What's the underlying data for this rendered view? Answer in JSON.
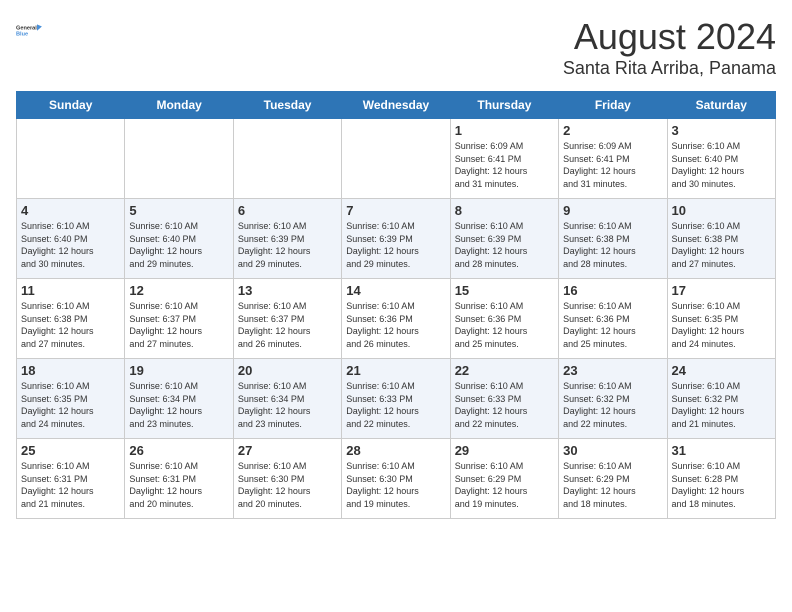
{
  "logo": {
    "line1": "General",
    "line2": "Blue"
  },
  "title": "August 2024",
  "subtitle": "Santa Rita Arriba, Panama",
  "weekdays": [
    "Sunday",
    "Monday",
    "Tuesday",
    "Wednesday",
    "Thursday",
    "Friday",
    "Saturday"
  ],
  "weeks": [
    [
      {
        "day": "",
        "info": ""
      },
      {
        "day": "",
        "info": ""
      },
      {
        "day": "",
        "info": ""
      },
      {
        "day": "",
        "info": ""
      },
      {
        "day": "1",
        "info": "Sunrise: 6:09 AM\nSunset: 6:41 PM\nDaylight: 12 hours\nand 31 minutes."
      },
      {
        "day": "2",
        "info": "Sunrise: 6:09 AM\nSunset: 6:41 PM\nDaylight: 12 hours\nand 31 minutes."
      },
      {
        "day": "3",
        "info": "Sunrise: 6:10 AM\nSunset: 6:40 PM\nDaylight: 12 hours\nand 30 minutes."
      }
    ],
    [
      {
        "day": "4",
        "info": "Sunrise: 6:10 AM\nSunset: 6:40 PM\nDaylight: 12 hours\nand 30 minutes."
      },
      {
        "day": "5",
        "info": "Sunrise: 6:10 AM\nSunset: 6:40 PM\nDaylight: 12 hours\nand 29 minutes."
      },
      {
        "day": "6",
        "info": "Sunrise: 6:10 AM\nSunset: 6:39 PM\nDaylight: 12 hours\nand 29 minutes."
      },
      {
        "day": "7",
        "info": "Sunrise: 6:10 AM\nSunset: 6:39 PM\nDaylight: 12 hours\nand 29 minutes."
      },
      {
        "day": "8",
        "info": "Sunrise: 6:10 AM\nSunset: 6:39 PM\nDaylight: 12 hours\nand 28 minutes."
      },
      {
        "day": "9",
        "info": "Sunrise: 6:10 AM\nSunset: 6:38 PM\nDaylight: 12 hours\nand 28 minutes."
      },
      {
        "day": "10",
        "info": "Sunrise: 6:10 AM\nSunset: 6:38 PM\nDaylight: 12 hours\nand 27 minutes."
      }
    ],
    [
      {
        "day": "11",
        "info": "Sunrise: 6:10 AM\nSunset: 6:38 PM\nDaylight: 12 hours\nand 27 minutes."
      },
      {
        "day": "12",
        "info": "Sunrise: 6:10 AM\nSunset: 6:37 PM\nDaylight: 12 hours\nand 27 minutes."
      },
      {
        "day": "13",
        "info": "Sunrise: 6:10 AM\nSunset: 6:37 PM\nDaylight: 12 hours\nand 26 minutes."
      },
      {
        "day": "14",
        "info": "Sunrise: 6:10 AM\nSunset: 6:36 PM\nDaylight: 12 hours\nand 26 minutes."
      },
      {
        "day": "15",
        "info": "Sunrise: 6:10 AM\nSunset: 6:36 PM\nDaylight: 12 hours\nand 25 minutes."
      },
      {
        "day": "16",
        "info": "Sunrise: 6:10 AM\nSunset: 6:36 PM\nDaylight: 12 hours\nand 25 minutes."
      },
      {
        "day": "17",
        "info": "Sunrise: 6:10 AM\nSunset: 6:35 PM\nDaylight: 12 hours\nand 24 minutes."
      }
    ],
    [
      {
        "day": "18",
        "info": "Sunrise: 6:10 AM\nSunset: 6:35 PM\nDaylight: 12 hours\nand 24 minutes."
      },
      {
        "day": "19",
        "info": "Sunrise: 6:10 AM\nSunset: 6:34 PM\nDaylight: 12 hours\nand 23 minutes."
      },
      {
        "day": "20",
        "info": "Sunrise: 6:10 AM\nSunset: 6:34 PM\nDaylight: 12 hours\nand 23 minutes."
      },
      {
        "day": "21",
        "info": "Sunrise: 6:10 AM\nSunset: 6:33 PM\nDaylight: 12 hours\nand 22 minutes."
      },
      {
        "day": "22",
        "info": "Sunrise: 6:10 AM\nSunset: 6:33 PM\nDaylight: 12 hours\nand 22 minutes."
      },
      {
        "day": "23",
        "info": "Sunrise: 6:10 AM\nSunset: 6:32 PM\nDaylight: 12 hours\nand 22 minutes."
      },
      {
        "day": "24",
        "info": "Sunrise: 6:10 AM\nSunset: 6:32 PM\nDaylight: 12 hours\nand 21 minutes."
      }
    ],
    [
      {
        "day": "25",
        "info": "Sunrise: 6:10 AM\nSunset: 6:31 PM\nDaylight: 12 hours\nand 21 minutes."
      },
      {
        "day": "26",
        "info": "Sunrise: 6:10 AM\nSunset: 6:31 PM\nDaylight: 12 hours\nand 20 minutes."
      },
      {
        "day": "27",
        "info": "Sunrise: 6:10 AM\nSunset: 6:30 PM\nDaylight: 12 hours\nand 20 minutes."
      },
      {
        "day": "28",
        "info": "Sunrise: 6:10 AM\nSunset: 6:30 PM\nDaylight: 12 hours\nand 19 minutes."
      },
      {
        "day": "29",
        "info": "Sunrise: 6:10 AM\nSunset: 6:29 PM\nDaylight: 12 hours\nand 19 minutes."
      },
      {
        "day": "30",
        "info": "Sunrise: 6:10 AM\nSunset: 6:29 PM\nDaylight: 12 hours\nand 18 minutes."
      },
      {
        "day": "31",
        "info": "Sunrise: 6:10 AM\nSunset: 6:28 PM\nDaylight: 12 hours\nand 18 minutes."
      }
    ]
  ]
}
